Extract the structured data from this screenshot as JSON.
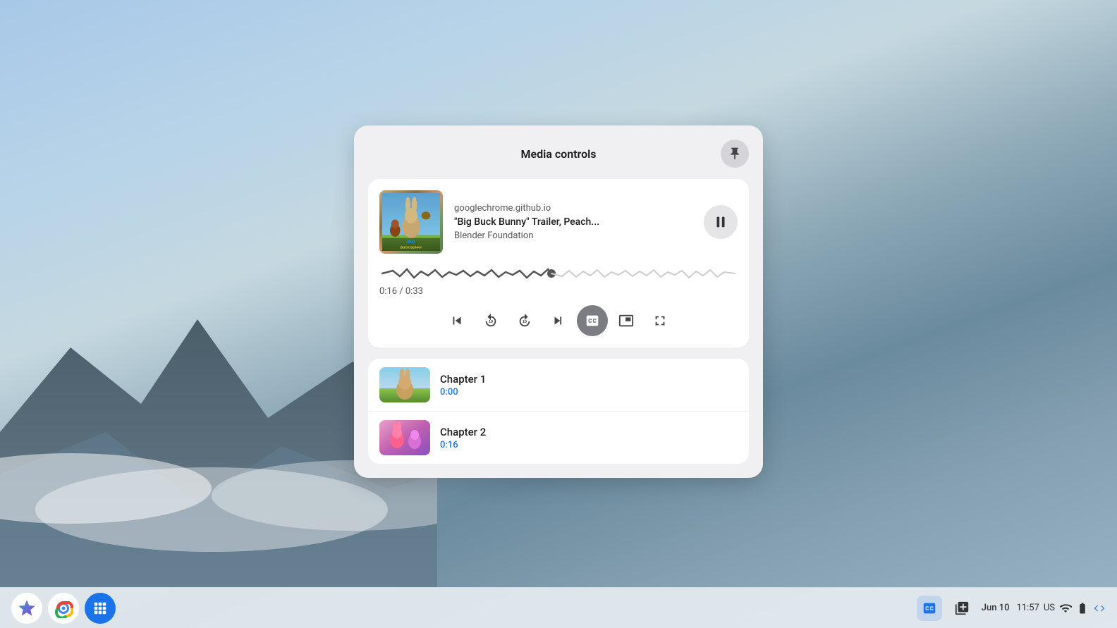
{
  "desktop": {
    "background": "sky-mountain"
  },
  "media_panel": {
    "title": "Media controls",
    "pin_button_label": "Pin",
    "now_playing": {
      "source": "googlechrome.github.io",
      "title": "\"Big Buck Bunny\" Trailer, Peach...",
      "artist": "Blender Foundation",
      "current_time": "0:16",
      "total_time": "0:33",
      "time_display": "0:16 / 0:33",
      "progress_percent": 48
    },
    "controls": {
      "skip_back_label": "Skip to beginning",
      "rewind_label": "Rewind 10 seconds",
      "forward_label": "Forward 10 seconds",
      "skip_forward_label": "Skip to end",
      "toggle_captions_label": "Toggle captions",
      "pip_label": "Picture in picture",
      "fullscreen_label": "Fullscreen"
    },
    "chapters": [
      {
        "name": "Chapter 1",
        "time": "0:00",
        "thumb_type": "green-field"
      },
      {
        "name": "Chapter 2",
        "time": "0:16",
        "thumb_type": "pink-creature"
      }
    ]
  },
  "taskbar": {
    "date": "Jun 10",
    "time": "11:57",
    "locale": "US",
    "apps": [
      {
        "name": "Launcher",
        "icon": "star"
      },
      {
        "name": "Chrome",
        "icon": "chrome"
      },
      {
        "name": "App Grid",
        "icon": "grid"
      }
    ],
    "system": [
      {
        "name": "Media",
        "icon": "media-icon",
        "active": true
      },
      {
        "name": "Queue",
        "icon": "queue-icon",
        "active": false
      }
    ]
  }
}
